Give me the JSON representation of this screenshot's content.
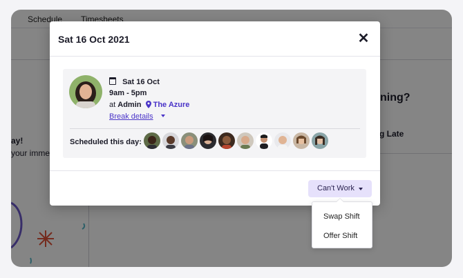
{
  "nav": {
    "schedule": "Schedule",
    "timesheets": "Timesheets"
  },
  "background": {
    "left_heading_fragment": "ay!",
    "left_text_fragment": "your immed",
    "right_heading_fragment": "ning?",
    "right_item_fragment": "g Late"
  },
  "modal": {
    "title": "Sat 16 Oct 2021",
    "close_icon": "close-icon",
    "shift": {
      "date": "Sat 16 Oct",
      "time": "9am - 5pm",
      "at_prefix": "at",
      "role": "Admin",
      "location": "The Azure",
      "break_details": "Break details"
    },
    "scheduled_label": "Scheduled this day:",
    "scheduled_count": 10,
    "cant_work_label": "Can't Work"
  },
  "dropdown": {
    "items": [
      "Swap Shift",
      "Offer Shift"
    ]
  },
  "colors": {
    "accent": "#4a34c8",
    "button_bg": "#e6e1fb",
    "overlay": "#00000080"
  }
}
